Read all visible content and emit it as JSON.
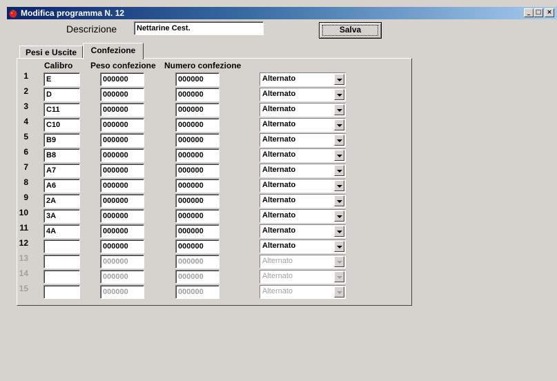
{
  "window": {
    "title": "Modifica programma N. 12",
    "icon": "tomato-icon",
    "controls": [
      "_",
      "□",
      "×"
    ]
  },
  "form": {
    "descrizione_label": "Descrizione",
    "descrizione_value": "Nettarine Cest.",
    "save_label": "Salva"
  },
  "tabs": [
    {
      "label": "Pesi e Uscite",
      "active": false
    },
    {
      "label": "Confezione",
      "active": true
    }
  ],
  "columns": {
    "calibro": "Calibro",
    "peso": "Peso confezione",
    "numero": "Numero confezione"
  },
  "rows": [
    {
      "num": "1",
      "calibro": "E",
      "peso": "000000",
      "numero": "000000",
      "tipo": "Alternato",
      "enabled": true
    },
    {
      "num": "2",
      "calibro": "D",
      "peso": "000000",
      "numero": "000000",
      "tipo": "Alternato",
      "enabled": true
    },
    {
      "num": "3",
      "calibro": "C11",
      "peso": "000000",
      "numero": "000000",
      "tipo": "Alternato",
      "enabled": true
    },
    {
      "num": "4",
      "calibro": "C10",
      "peso": "000000",
      "numero": "000000",
      "tipo": "Alternato",
      "enabled": true
    },
    {
      "num": "5",
      "calibro": "B9",
      "peso": "000000",
      "numero": "000000",
      "tipo": "Alternato",
      "enabled": true
    },
    {
      "num": "6",
      "calibro": "B8",
      "peso": "000000",
      "numero": "000000",
      "tipo": "Alternato",
      "enabled": true
    },
    {
      "num": "7",
      "calibro": "A7",
      "peso": "000000",
      "numero": "000000",
      "tipo": "Alternato",
      "enabled": true
    },
    {
      "num": "8",
      "calibro": "A6",
      "peso": "000000",
      "numero": "000000",
      "tipo": "Alternato",
      "enabled": true
    },
    {
      "num": "9",
      "calibro": "2A",
      "peso": "000000",
      "numero": "000000",
      "tipo": "Alternato",
      "enabled": true
    },
    {
      "num": "10",
      "calibro": "3A",
      "peso": "000000",
      "numero": "000000",
      "tipo": "Alternato",
      "enabled": true
    },
    {
      "num": "11",
      "calibro": "4A",
      "peso": "000000",
      "numero": "000000",
      "tipo": "Alternato",
      "enabled": true
    },
    {
      "num": "12",
      "calibro": "",
      "peso": "000000",
      "numero": "000000",
      "tipo": "Alternato",
      "enabled": true
    },
    {
      "num": "13",
      "calibro": "",
      "peso": "000000",
      "numero": "000000",
      "tipo": "Alternato",
      "enabled": false
    },
    {
      "num": "14",
      "calibro": "",
      "peso": "000000",
      "numero": "000000",
      "tipo": "Alternato",
      "enabled": false
    },
    {
      "num": "15",
      "calibro": "",
      "peso": "000000",
      "numero": "000000",
      "tipo": "Alternato",
      "enabled": false
    }
  ]
}
